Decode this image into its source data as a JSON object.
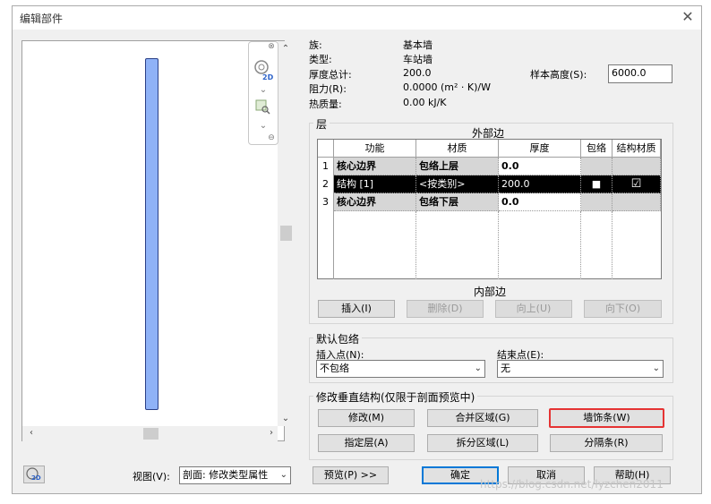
{
  "window": {
    "title": "编辑部件",
    "close_glyph": "✕"
  },
  "properties": {
    "family_label": "族:",
    "family_value": "基本墙",
    "type_label": "类型:",
    "type_value": "车站墙",
    "thickness_label": "厚度总计:",
    "thickness_value": "200.0",
    "resistance_label": "阻力(R):",
    "resistance_value": "0.0000 (m² · K)/W",
    "thermal_mass_label": "热质量:",
    "thermal_mass_value": "0.00 kJ/K",
    "sample_height_label": "样本高度(S):",
    "sample_height_value": "6000.0"
  },
  "layers": {
    "group_title": "层",
    "exterior_label": "外部边",
    "interior_label": "内部边",
    "columns": [
      "功能",
      "材质",
      "厚度",
      "包络",
      "结构材质"
    ],
    "rows": [
      {
        "num": "1",
        "function": "核心边界",
        "material": "包络上层",
        "thickness": "0.0"
      },
      {
        "num": "2",
        "function": "结构 [1]",
        "material": "<按类别>",
        "thickness": "200.0",
        "wrap_glyph": "■",
        "struct_glyph": "☑"
      },
      {
        "num": "3",
        "function": "核心边界",
        "material": "包络下层",
        "thickness": "0.0"
      }
    ],
    "buttons": {
      "insert": "插入(I)",
      "delete": "删除(D)",
      "up": "向上(U)",
      "down": "向下(O)"
    }
  },
  "default_wrap": {
    "group_title": "默认包络",
    "insert_label": "插入点(N):",
    "insert_value": "不包络",
    "end_label": "结束点(E):",
    "end_value": "无"
  },
  "vertical": {
    "group_title": "修改垂直结构(仅限于剖面预览中)",
    "modify": "修改(M)",
    "merge": "合并区域(G)",
    "sweeps": "墙饰条(W)",
    "assign": "指定层(A)",
    "split": "拆分区域(L)",
    "reveals": "分隔条(R)"
  },
  "footer": {
    "view_label": "视图(V):",
    "view_value": "剖面: 修改类型属性",
    "preview": "预览(P) >>",
    "ok": "确定",
    "cancel": "取消",
    "help": "帮助(H)"
  },
  "icons": {
    "nav_2d_text": "2D",
    "footer_2d_text": "2D"
  },
  "watermark": "https://blog.csdn.net/lyzchen2011",
  "colors": {
    "wall_fill": "#8fb2f7",
    "highlight": "#e53333",
    "accent": "#0078d7"
  }
}
